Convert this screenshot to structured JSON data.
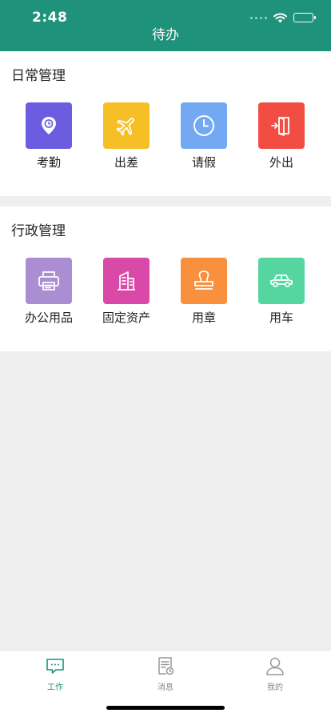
{
  "status_bar": {
    "time": "2:48"
  },
  "nav": {
    "title": "待办"
  },
  "sections": {
    "daily": {
      "title": "日常管理",
      "items": [
        {
          "label": "考勤",
          "icon": "location-pin-icon",
          "color": "#6b5ce0"
        },
        {
          "label": "出差",
          "icon": "airplane-icon",
          "color": "#f6bf26"
        },
        {
          "label": "请假",
          "icon": "clock-icon",
          "color": "#73a9f2"
        },
        {
          "label": "外出",
          "icon": "exit-door-icon",
          "color": "#f24d42"
        }
      ]
    },
    "admin": {
      "title": "行政管理",
      "items": [
        {
          "label": "办公用品",
          "icon": "printer-icon",
          "color": "#ab8ed2"
        },
        {
          "label": "固定资产",
          "icon": "building-icon",
          "color": "#d94aa8"
        },
        {
          "label": "用章",
          "icon": "stamp-icon",
          "color": "#f8903e"
        },
        {
          "label": "用车",
          "icon": "car-icon",
          "color": "#55d6a1"
        }
      ]
    }
  },
  "tabbar": {
    "tabs": [
      {
        "label": "工作",
        "icon": "chat-bubble-icon",
        "active": true
      },
      {
        "label": "消息",
        "icon": "document-clock-icon",
        "active": false
      },
      {
        "label": "我的",
        "icon": "user-icon",
        "active": false
      }
    ],
    "active_color": "#1f927b"
  },
  "theme": {
    "primary": "#1f927b",
    "background": "#efefef"
  }
}
